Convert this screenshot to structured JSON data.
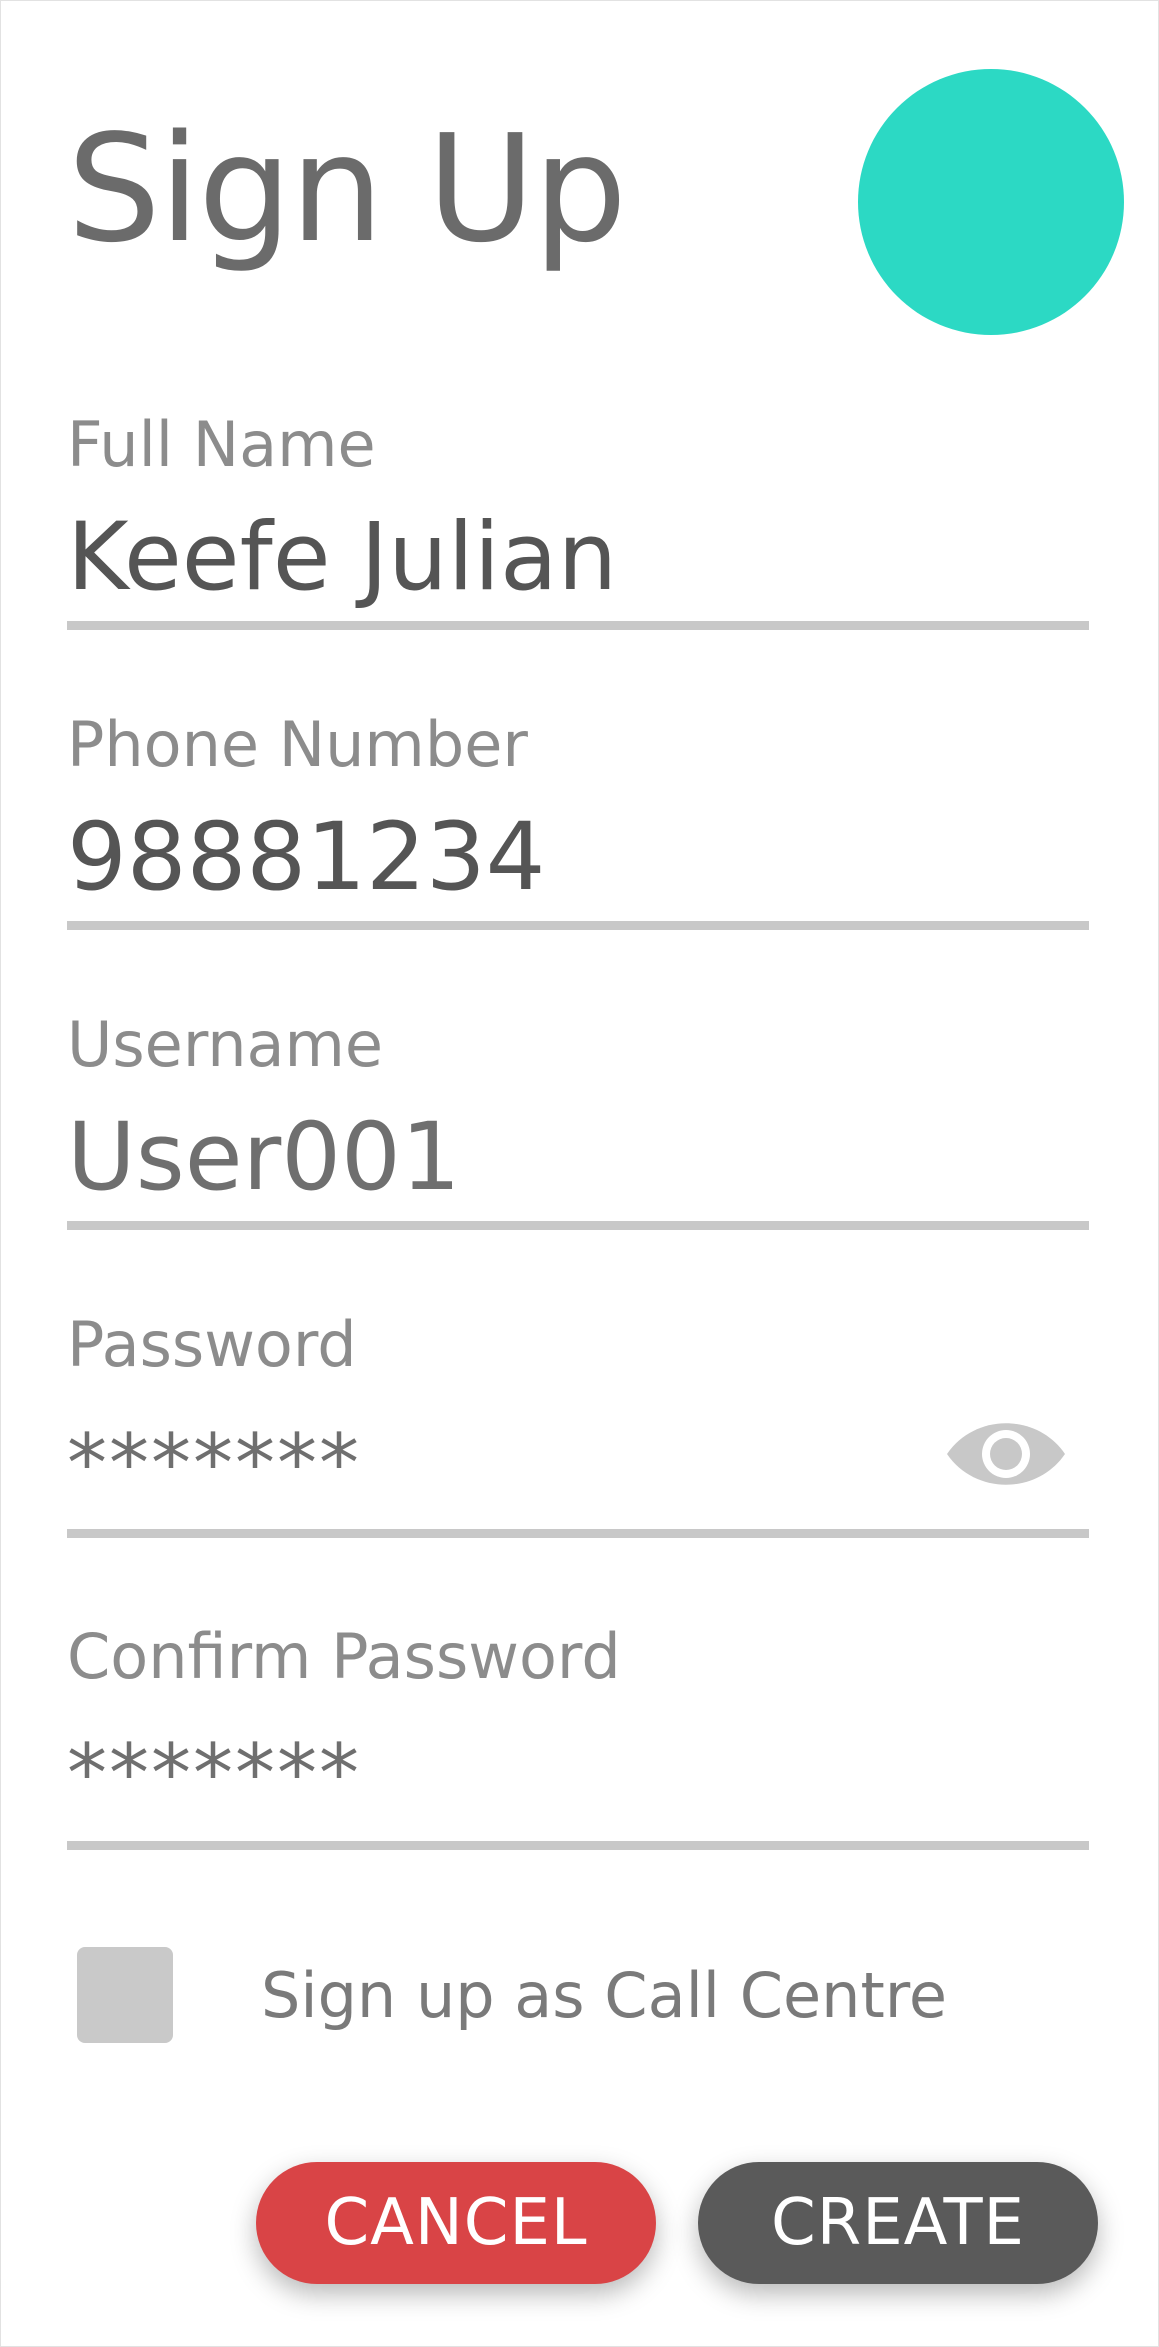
{
  "title": "Sign Up",
  "colors": {
    "avatar": "#2cd9c4",
    "cancel": "#d94446",
    "create": "#5a5a5a"
  },
  "fields": {
    "full_name": {
      "label": "Full Name",
      "value": "Keefe Julian"
    },
    "phone": {
      "label": "Phone Number",
      "value": "98881234"
    },
    "username": {
      "label": "Username",
      "value": "User001"
    },
    "password": {
      "label": "Password",
      "value": "*******",
      "toggle_icon": "eye-icon"
    },
    "confirm_password": {
      "label": "Confirm Password",
      "value": "*******"
    }
  },
  "call_centre": {
    "label": "Sign up as Call Centre",
    "checked": false
  },
  "buttons": {
    "cancel": "CANCEL",
    "create": "CREATE"
  }
}
